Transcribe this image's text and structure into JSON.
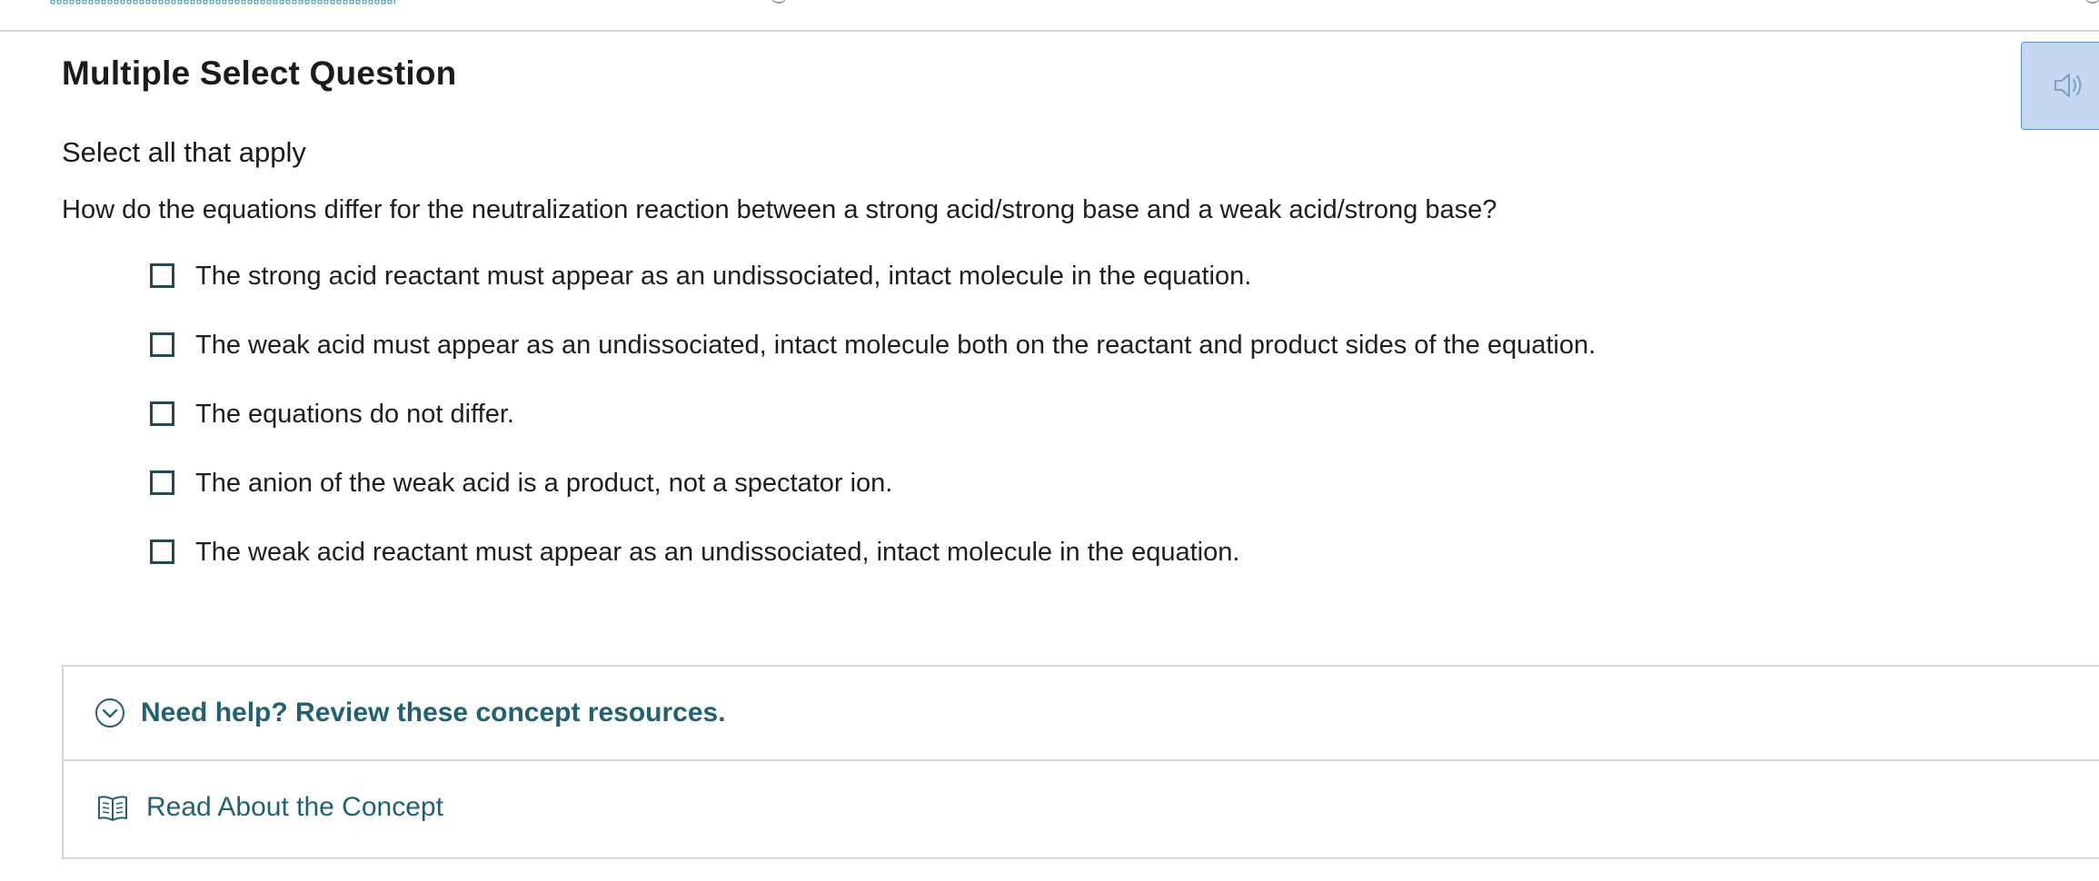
{
  "question": {
    "title": "Multiple Select Question",
    "instruction": "Select all that apply",
    "prompt": "How do the equations differ for the neutralization reaction between a strong acid/strong base and a weak acid/strong base?",
    "options": [
      {
        "label": "The strong acid reactant must appear as an undissociated, intact molecule in the equation.",
        "checked": false
      },
      {
        "label": "The weak acid must appear as an undissociated, intact molecule both on the reactant and product sides of the equation.",
        "checked": false
      },
      {
        "label": "The equations do not differ.",
        "checked": false
      },
      {
        "label": "The anion of the weak acid is a product, not a spectator ion.",
        "checked": false
      },
      {
        "label": "The weak acid reactant must appear as an undissociated, intact molecule in the equation.",
        "checked": false
      }
    ]
  },
  "audio": {
    "icon": "speaker-icon"
  },
  "help": {
    "toggle_label": "Need help? Review these concept resources.",
    "toggle_icon": "chevron-down-circle-icon",
    "resource_label": "Read About the Concept",
    "resource_icon": "book-icon"
  },
  "colors": {
    "accent": "#24616e",
    "checkbox_border": "#26484f",
    "audio_bg": "#c5d8f2",
    "progress": "#2e8b9a"
  }
}
